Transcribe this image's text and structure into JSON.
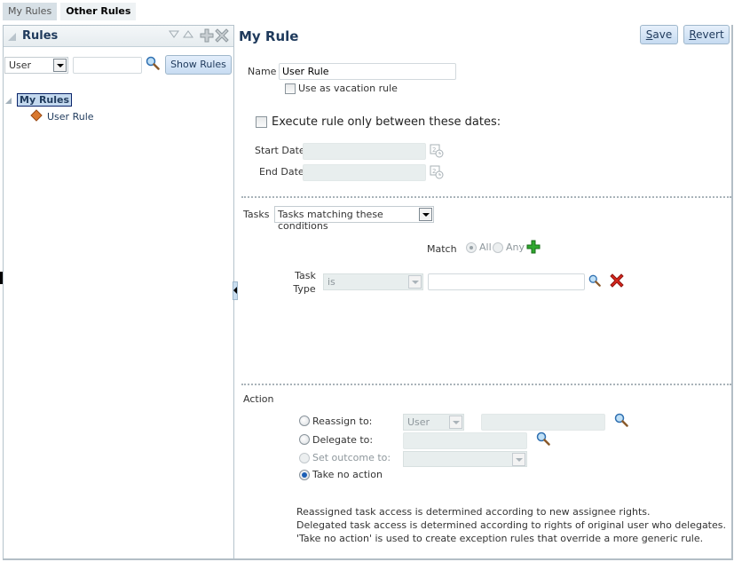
{
  "tabs": [
    {
      "label": "My Rules",
      "active": false
    },
    {
      "label": "Other Rules",
      "active": true
    }
  ],
  "left_panel": {
    "title": "Rules",
    "header_icons": [
      "expand-down-icon",
      "collapse-up-icon",
      "add-icon",
      "delete-icon"
    ],
    "filter_select": {
      "value": "User"
    },
    "filter_input": {
      "value": ""
    },
    "show_rules_label": "Show Rules",
    "tree": {
      "root": {
        "label": "My Rules",
        "selected": true,
        "expanded": true
      },
      "children": [
        {
          "label": "User Rule",
          "icon": "rule-diamond-icon"
        }
      ]
    }
  },
  "rule": {
    "title": "My Rule",
    "save_label": "Save",
    "save_access_key": "S",
    "revert_label": "Revert",
    "revert_access_key": "R",
    "name_label": "Name",
    "name_value": "User Rule",
    "vacation_label": "Use as vacation rule",
    "vacation_checked": false,
    "execute_dates_label": "Execute rule only between these dates:",
    "execute_dates_checked": false,
    "start_date_label": "Start Date",
    "start_date_value": "",
    "end_date_label": "End Date",
    "end_date_value": "",
    "tasks_label": "Tasks",
    "tasks_select_value": "Tasks matching these conditions",
    "match_label": "Match",
    "match_options": [
      {
        "label": "All",
        "selected": true
      },
      {
        "label": "Any",
        "selected": false
      }
    ],
    "condition": {
      "label_line1": "Task",
      "label_line2": "Type",
      "operator_value": "is",
      "value": ""
    },
    "action_label": "Action",
    "actions": [
      {
        "label": "Reassign to:",
        "selected": false,
        "enabled": true
      },
      {
        "label": "Delegate to:",
        "selected": false,
        "enabled": true
      },
      {
        "label": "Set outcome to:",
        "selected": false,
        "enabled": false
      },
      {
        "label": "Take no action",
        "selected": true,
        "enabled": true
      }
    ],
    "reassign_type_value": "User",
    "reassign_value": "",
    "delegate_value": "",
    "outcome_value": "",
    "help_lines": [
      "Reassigned task access is determined according to new assignee rights.",
      "Delegated task access is determined according to rights of original user who delegates.",
      "'Take no action' is used to create exception rules that override a more generic rule."
    ]
  },
  "colors": {
    "accent_title": "#1f3a5c",
    "button_bg": "#c6dbf1",
    "disabled_field": "#e8eeee",
    "selected_radio": "#1c5fb5",
    "add_green": "#2fa82f",
    "delete_red": "#d9261c"
  }
}
